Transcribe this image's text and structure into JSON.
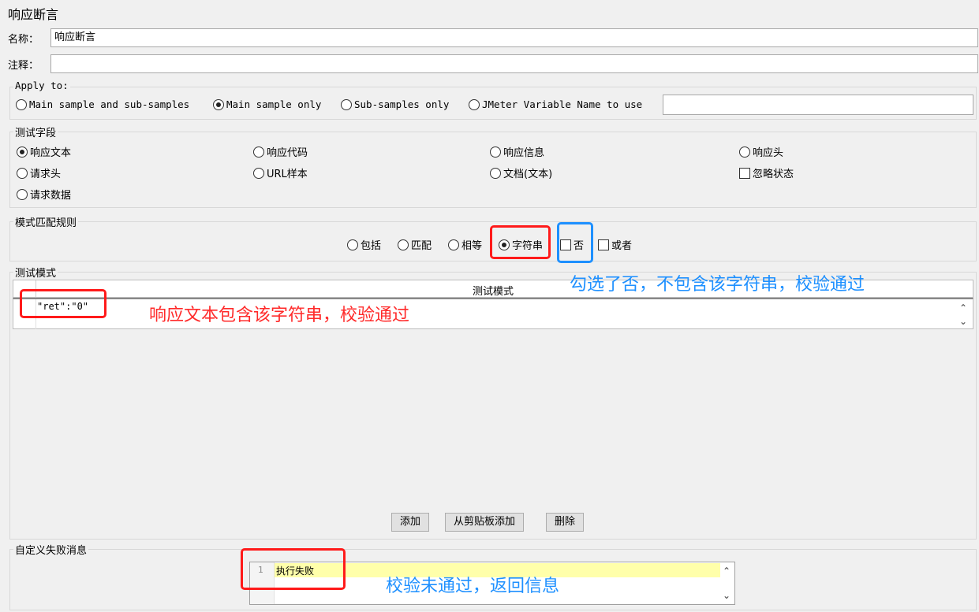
{
  "title": "响应断言",
  "name_field": {
    "label": "名称：",
    "value": "响应断言"
  },
  "comment_field": {
    "label": "注释：",
    "value": ""
  },
  "apply_to": {
    "title": "Apply to:",
    "options": [
      "Main sample and sub-samples",
      "Main sample only",
      "Sub-samples only",
      "JMeter Variable Name to use"
    ],
    "selected": "Main sample only",
    "variable_value": ""
  },
  "test_field": {
    "title": "测试字段",
    "options": [
      "响应文本",
      "响应代码",
      "响应信息",
      "响应头",
      "请求头",
      "URL样本",
      "文档(文本)",
      "请求数据"
    ],
    "selected": "响应文本",
    "ignore_status": {
      "label": "忽略状态",
      "checked": false
    }
  },
  "pattern_rules": {
    "title": "模式匹配规则",
    "options": [
      "包括",
      "匹配",
      "相等",
      "字符串"
    ],
    "selected": "字符串",
    "not": {
      "label": "否",
      "checked": false
    },
    "or": {
      "label": "或者",
      "checked": false
    }
  },
  "test_patterns": {
    "title": "测试模式",
    "column_header": "测试模式",
    "rows": [
      "\"ret\":\"0\""
    ],
    "buttons": {
      "add": "添加",
      "add_from_clipboard": "从剪贴板添加",
      "delete": "删除"
    }
  },
  "custom_failure": {
    "title": "自定义失败消息",
    "line_number": "1",
    "text": "执行失败"
  },
  "annotations": {
    "contains_note": "响应文本包含该字符串，校验通过",
    "not_note": "勾选了否，不包含该字符串，校验通过",
    "failure_note": "校验未通过，返回信息"
  },
  "colors": {
    "annotation_red": "#ff1a1a",
    "annotation_blue": "#1e90ff",
    "editor_highlight": "#ffffaa"
  }
}
